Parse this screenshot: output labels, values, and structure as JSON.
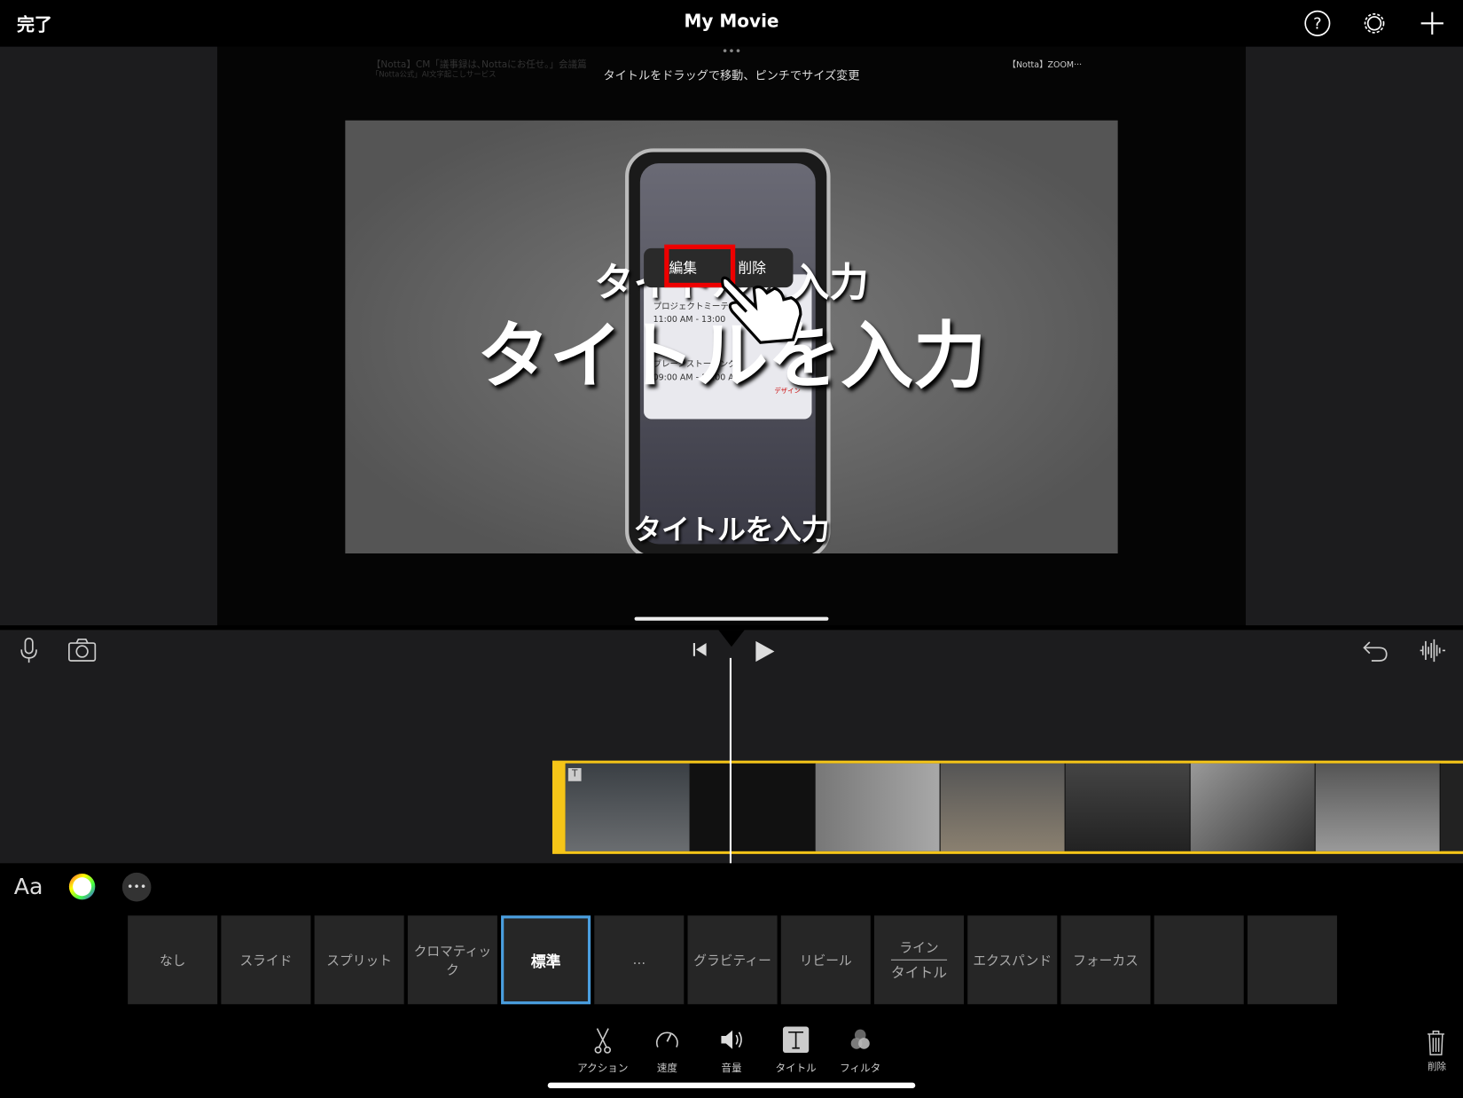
{
  "topbar": {
    "done_label": "完了",
    "title": "My Movie",
    "icons": [
      "help-icon",
      "settings-icon",
      "add-icon"
    ]
  },
  "preview": {
    "hint": "タイトルをドラッグで移動、ピンチでサイズ変更",
    "background_video_title": "【Notta】CM「議事録は､Nottaにお任せ｡」会議篇",
    "background_channel": "「Notta公式」AI文字起こしサービス",
    "background_related": "【Notta】ZOOM···",
    "title_top": "タイトルを入力",
    "title_main": "タイトルを入力",
    "title_bottom": "タイトルを入力",
    "popup": {
      "edit": "編集",
      "delete": "削除"
    },
    "card_items": [
      "プロジェクトミーティ…",
      "11:00 AM - 13:00",
      "ブレーンストーミング",
      "09:00 AM - 10:00 AM",
      "デザイン"
    ]
  },
  "controls": {
    "icons": [
      "microphone-icon",
      "camera-icon",
      "skip-back-icon",
      "play-icon",
      "undo-icon",
      "waveform-icon"
    ]
  },
  "title_tools": {
    "font_label": "Aa",
    "icons": [
      "color-wheel-icon",
      "more-icon"
    ]
  },
  "styles": [
    {
      "label": "なし"
    },
    {
      "label": "スライド"
    },
    {
      "label": "スプリット"
    },
    {
      "label": "クロマティック"
    },
    {
      "label": "標準",
      "selected": true
    },
    {
      "label": "…"
    },
    {
      "label": "グラビティー"
    },
    {
      "label": "リビール"
    },
    {
      "label": "ライン",
      "label2": "タイトル"
    },
    {
      "label": "エクスパンド"
    },
    {
      "label": "フォーカス"
    },
    {
      "label": ""
    },
    {
      "label": ""
    }
  ],
  "toolbar": [
    {
      "label": "アクション",
      "icon": "scissors-icon"
    },
    {
      "label": "速度",
      "icon": "speed-icon"
    },
    {
      "label": "音量",
      "icon": "volume-icon"
    },
    {
      "label": "タイトル",
      "icon": "title-icon",
      "active": true
    },
    {
      "label": "フィルタ",
      "icon": "filter-icon"
    }
  ],
  "delete_label": "削除",
  "colors": {
    "accent": "#4a9fe0",
    "clip_border": "#f5c518",
    "highlight": "#e00000"
  }
}
